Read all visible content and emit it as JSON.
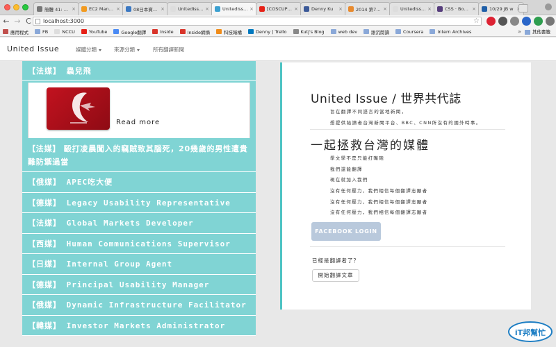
{
  "browser": {
    "tabs": [
      {
        "label": "簡體 41: 東北",
        "favicon_color": "#777777"
      },
      {
        "label": "EC2 Manage",
        "favicon_color": "#f29a1f"
      },
      {
        "label": "08日本寶永坂",
        "favicon_color": "#3b78c2"
      },
      {
        "label": "UnitedIssue",
        "favicon_color": "#dddddd"
      },
      {
        "label": "UnitedIssue",
        "favicon_color": "#3ca0d0",
        "active": true
      },
      {
        "label": "[COSCUP 20",
        "favicon_color": "#e62117"
      },
      {
        "label": "Denny Ku",
        "favicon_color": "#3b5998"
      },
      {
        "label": "2014 第7屆IT",
        "favicon_color": "#e88a2e"
      },
      {
        "label": "UnitedIssue",
        "favicon_color": "#dddddd"
      },
      {
        "label": "CSS · Boots",
        "favicon_color": "#563d7c"
      },
      {
        "label": "10/29 JB w",
        "favicon_color": "#1f5fa8"
      }
    ],
    "url": "localhost:3000",
    "back_label": "←",
    "forward_label": "→",
    "reload_label": "C",
    "star_label": "☆",
    "bookmarks": [
      {
        "label": "應用程式",
        "icon_color": "#c0504d"
      },
      {
        "label": "FB",
        "icon_color": "#8aa8d8"
      },
      {
        "label": "NCCU",
        "icon_color": "#dddddd"
      },
      {
        "label": "YouTube",
        "icon_color": "#e62117"
      },
      {
        "label": "Google翻譯",
        "icon_color": "#4a8af4"
      },
      {
        "label": "Inside",
        "icon_color": "#d9352b"
      },
      {
        "label": "Inside網摘",
        "icon_color": "#d9352b"
      },
      {
        "label": "科技報橘",
        "icon_color": "#f08c1a"
      },
      {
        "label": "Denny | Trello",
        "icon_color": "#0079bf"
      },
      {
        "label": "Kutj's Blog",
        "icon_color": "#888888"
      },
      {
        "label": "web dev",
        "icon_color": "#8aa8d8"
      },
      {
        "label": "跟沉閱讀",
        "icon_color": "#8aa8d8"
      },
      {
        "label": "Coursera",
        "icon_color": "#8aa8d8"
      },
      {
        "label": "Intern Archives",
        "icon_color": "#8aa8d8"
      }
    ],
    "bookmarks_more": "»",
    "other_bookmarks": "其他書籤"
  },
  "site": {
    "brand": "United Issue",
    "nav": [
      {
        "label": "媒體分類",
        "dropdown": true
      },
      {
        "label": "來源分類",
        "dropdown": true
      },
      {
        "label": "所有翻譯新聞",
        "dropdown": false
      }
    ]
  },
  "articles": {
    "first": "【法媒】 蟲兒飛",
    "read_more": "Read more",
    "items": [
      "【法媒】 毆打凌晨闖入的竊賊致其腦死，20幾歲的男性遭貴難防禦過當",
      "【俄媒】 APEC吃大便",
      "【德媒】 Legacy Usability Representative",
      "【法媒】 Global Markets Developer",
      "【西媒】 Human Communications Supervisor",
      "【日媒】 Internal Group Agent",
      "【德媒】 Principal Usability Manager",
      "【俄媒】 Dynamic Infrastructure Facilitator",
      "【韓媒】 Investor Markets Administrator"
    ]
  },
  "panel": {
    "title": "United Issue / 世界共代誌",
    "desc_1": "旨在翻譯不同語言的當地新聞，",
    "desc_2": "想提供給讀者台灣新聞平台、BBC、CNN所沒有的國外時事。",
    "heading2": "一起拯救台灣的媒體",
    "lines": [
      "學文學不是只能打嘴砲",
      "我們還能翻譯",
      "現在就加入我們",
      "沒有任何壓力，我們相信每個翻譯志願者",
      "沒有任何壓力，我們相信每個翻譯志願者",
      "沒有任何壓力，我們相信每個翻譯志願者"
    ],
    "fb_login": "FACEBOOK LOGIN",
    "question": "已經是翻譯者了？",
    "start_button": "開始翻譯文章"
  },
  "watermark": {
    "text": "iT邦幫忙"
  },
  "colors": {
    "list_bg": "#80d4d4",
    "panel_accent": "#4ec3c3",
    "fb_button": "#b9c9dc",
    "thumb_red": "#c2121f"
  }
}
